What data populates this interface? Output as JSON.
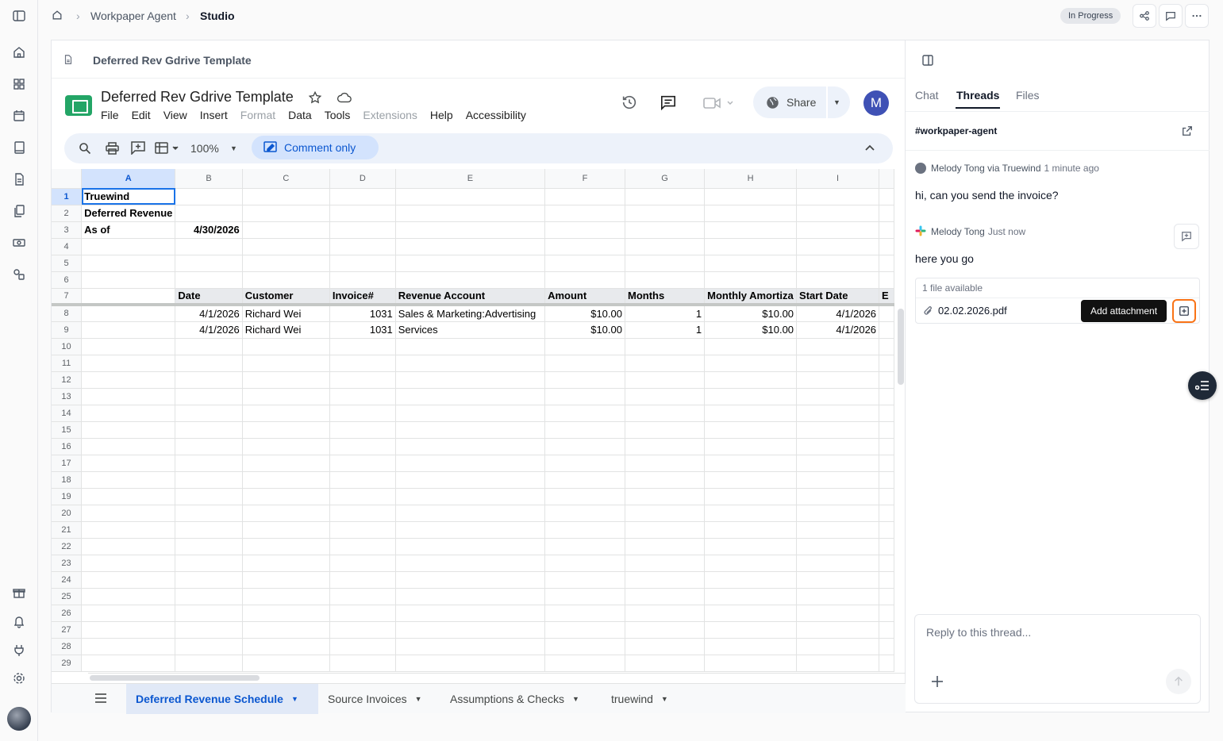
{
  "breadcrumb": {
    "parent": "Workpaper Agent",
    "current": "Studio"
  },
  "status": "In Progress",
  "doc": {
    "header_title": "Deferred Rev Gdrive Template"
  },
  "sheet": {
    "title": "Deferred Rev Gdrive Template",
    "menu": [
      "File",
      "Edit",
      "View",
      "Insert",
      "Format",
      "Data",
      "Tools",
      "Extensions",
      "Help",
      "Accessibility"
    ],
    "share_label": "Share",
    "user_initial": "M",
    "zoom": "100%",
    "mode_label": "Comment only",
    "columns": [
      "A",
      "B",
      "C",
      "D",
      "E",
      "F",
      "G",
      "H",
      "I"
    ],
    "rows": [
      [
        "Truewind",
        "",
        "",
        "",
        "",
        "",
        "",
        "",
        ""
      ],
      [
        "Deferred Revenue",
        "",
        "",
        "",
        "",
        "",
        "",
        "",
        ""
      ],
      [
        "As of",
        "4/30/2026",
        "",
        "",
        "",
        "",
        "",
        "",
        ""
      ],
      [
        "",
        "",
        "",
        "",
        "",
        "",
        "",
        "",
        ""
      ],
      [
        "",
        "",
        "",
        "",
        "",
        "",
        "",
        "",
        ""
      ],
      [
        "",
        "",
        "",
        "",
        "",
        "",
        "",
        "",
        ""
      ],
      [
        "",
        "Date",
        "Customer",
        "Invoice#",
        "Revenue Account",
        "Amount",
        "Months",
        "Monthly Amortiza",
        "Start Date"
      ],
      [
        "",
        "4/1/2026",
        "Richard Wei",
        "1031",
        "Sales & Marketing:Advertising",
        "$10.00",
        "1",
        "$10.00",
        "4/1/2026"
      ],
      [
        "",
        "4/1/2026",
        "Richard Wei",
        "1031",
        "Services",
        "$10.00",
        "1",
        "$10.00",
        "4/1/2026"
      ]
    ],
    "row_numbers": [
      "1",
      "2",
      "3",
      "4",
      "5",
      "6",
      "7",
      "8",
      "9",
      "10",
      "11",
      "12",
      "13",
      "14",
      "15",
      "16",
      "17",
      "18",
      "19",
      "20",
      "21",
      "22",
      "23",
      "24",
      "25",
      "26",
      "27",
      "28",
      "29"
    ],
    "overflow_col_label": "E",
    "tabs": [
      "Deferred Revenue Schedule",
      "Source Invoices",
      "Assumptions & Checks",
      "truewind"
    ]
  },
  "panel": {
    "tabs": [
      "Chat",
      "Threads",
      "Files"
    ],
    "channel": "#workpaper-agent",
    "messages": [
      {
        "author": "Melody Tong via Truewind",
        "time": "1 minute ago",
        "text": "hi, can you send the invoice?"
      },
      {
        "author": "Melody Tong",
        "time": "Just now",
        "text": "here you go"
      }
    ],
    "attachment": {
      "count_label": "1 file available",
      "file": "02.02.2026.pdf",
      "tooltip": "Add attachment"
    },
    "reply_placeholder": "Reply to this thread..."
  },
  "colors": {
    "accent_blue": "#0b57d0",
    "sheets_green": "#23a566",
    "highlight_orange": "#f97316"
  }
}
